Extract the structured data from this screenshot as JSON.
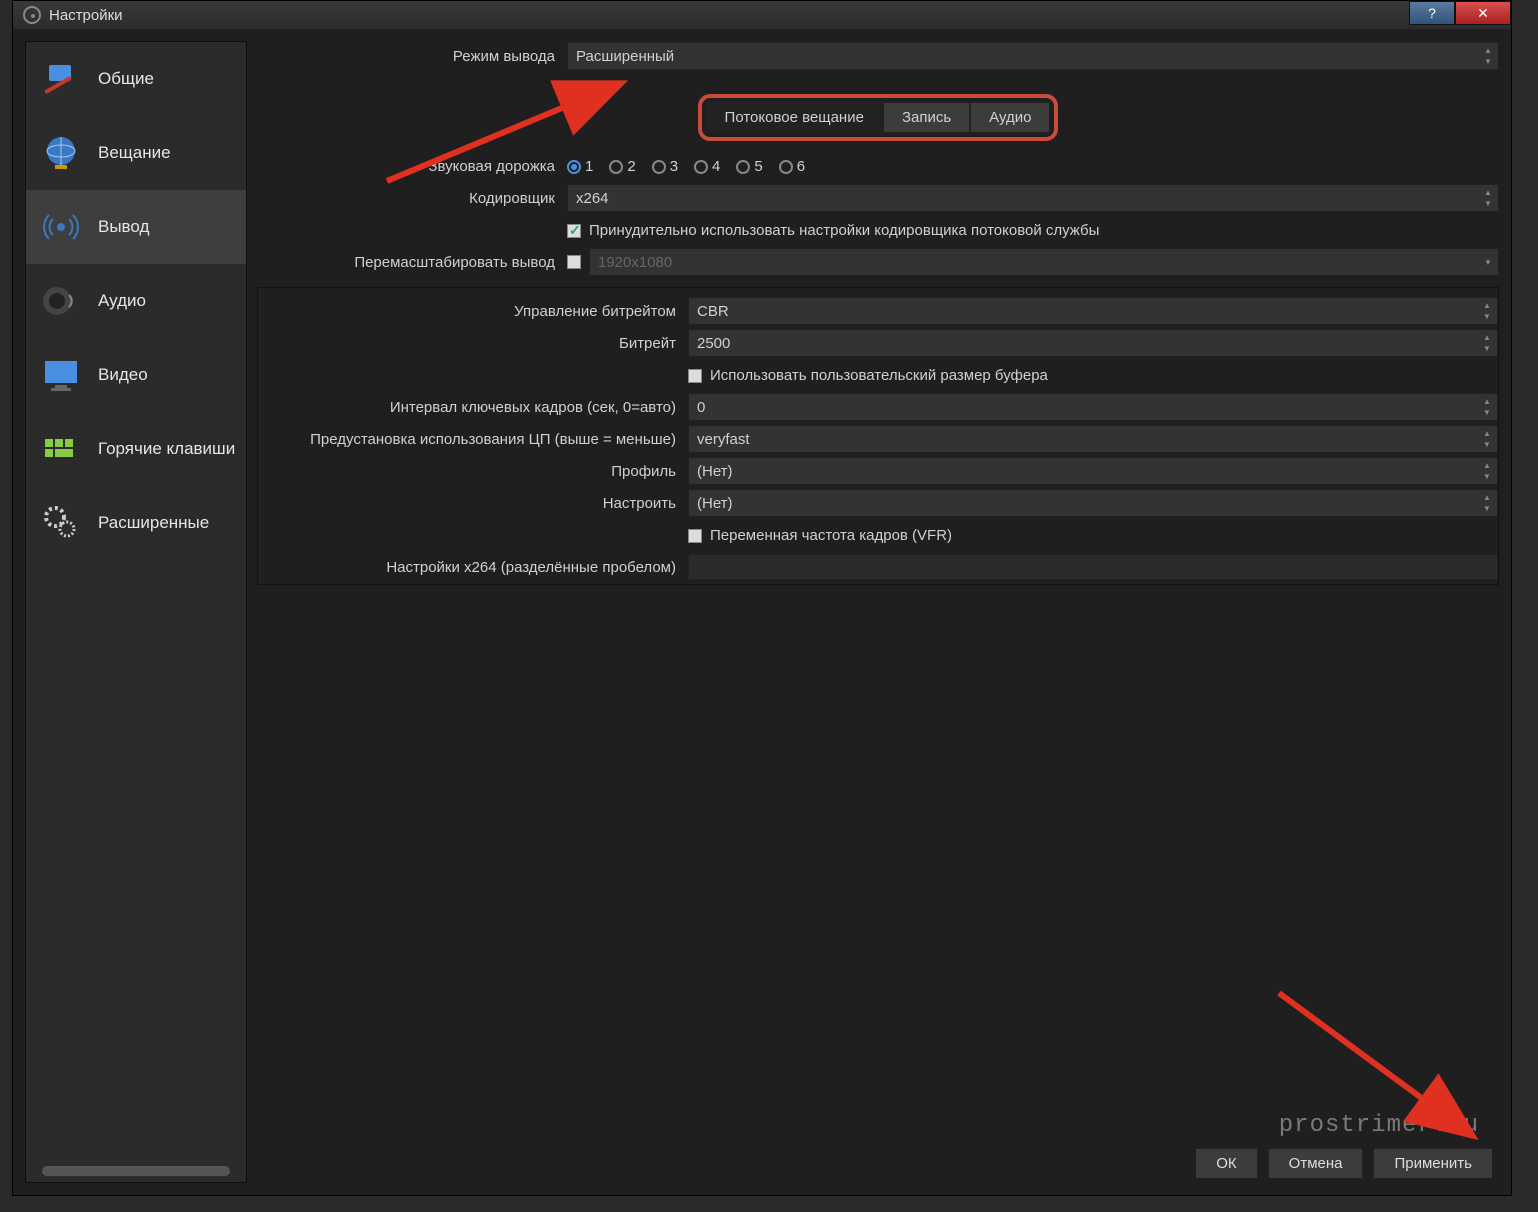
{
  "window_title": "Настройки",
  "sidebar": {
    "items": [
      {
        "label": "Общие"
      },
      {
        "label": "Вещание"
      },
      {
        "label": "Вывод"
      },
      {
        "label": "Аудио"
      },
      {
        "label": "Видео"
      },
      {
        "label": "Горячие клавиши"
      },
      {
        "label": "Расширенные"
      }
    ]
  },
  "output_mode_label": "Режим вывода",
  "output_mode_value": "Расширенный",
  "tabs": {
    "stream": "Потоковое вещание",
    "record": "Запись",
    "audio": "Аудио"
  },
  "audio_track_label": "Звуковая дорожка",
  "audio_tracks": [
    "1",
    "2",
    "3",
    "4",
    "5",
    "6"
  ],
  "encoder_label": "Кодировщик",
  "encoder_value": "x264",
  "enforce_label": "Принудительно использовать настройки кодировщика потоковой службы",
  "rescale_label": "Перемасштабировать вывод",
  "rescale_value": "1920x1080",
  "rate_control_label": "Управление битрейтом",
  "rate_control_value": "CBR",
  "bitrate_label": "Битрейт",
  "bitrate_value": "2500",
  "custom_buffer_label": "Использовать пользовательский размер буфера",
  "keyframe_label": "Интервал ключевых кадров (сек, 0=авто)",
  "keyframe_value": "0",
  "cpu_preset_label": "Предустановка использования ЦП (выше = меньше)",
  "cpu_preset_value": "veryfast",
  "profile_label": "Профиль",
  "profile_value": "(Нет)",
  "tune_label": "Настроить",
  "tune_value": "(Нет)",
  "vfr_label": "Переменная частота кадров (VFR)",
  "x264opts_label": "Настройки x264 (разделённые пробелом)",
  "buttons": {
    "ok": "ОК",
    "cancel": "Отмена",
    "apply": "Применить"
  },
  "watermark": "prostrimer.ru"
}
